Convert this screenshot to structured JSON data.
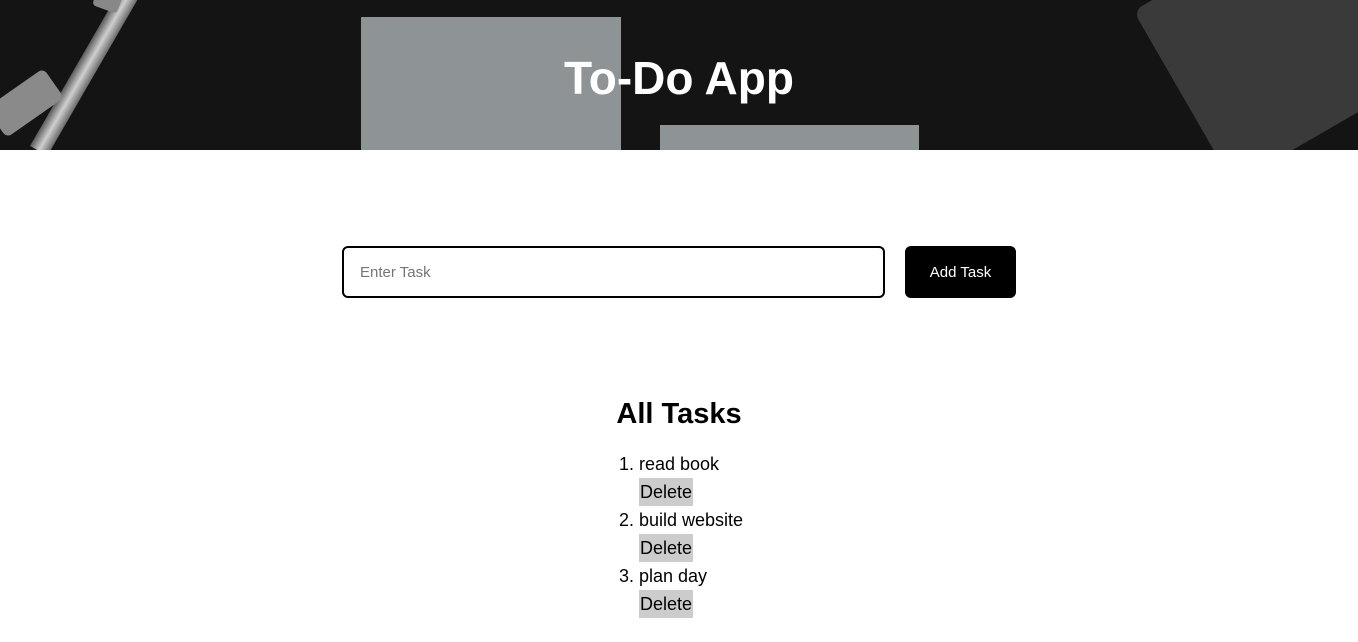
{
  "header": {
    "title": "To-Do App"
  },
  "task_form": {
    "placeholder": "Enter Task",
    "value": "",
    "add_label": "Add Task"
  },
  "tasks": {
    "heading": "All Tasks",
    "items": [
      {
        "text": "read book",
        "delete_label": "Delete"
      },
      {
        "text": "build website",
        "delete_label": "Delete"
      },
      {
        "text": "plan day",
        "delete_label": "Delete"
      }
    ]
  },
  "colors": {
    "primary_button": "#000000",
    "delete_button_bg": "#cccccc",
    "hero_bg": "#141414"
  }
}
